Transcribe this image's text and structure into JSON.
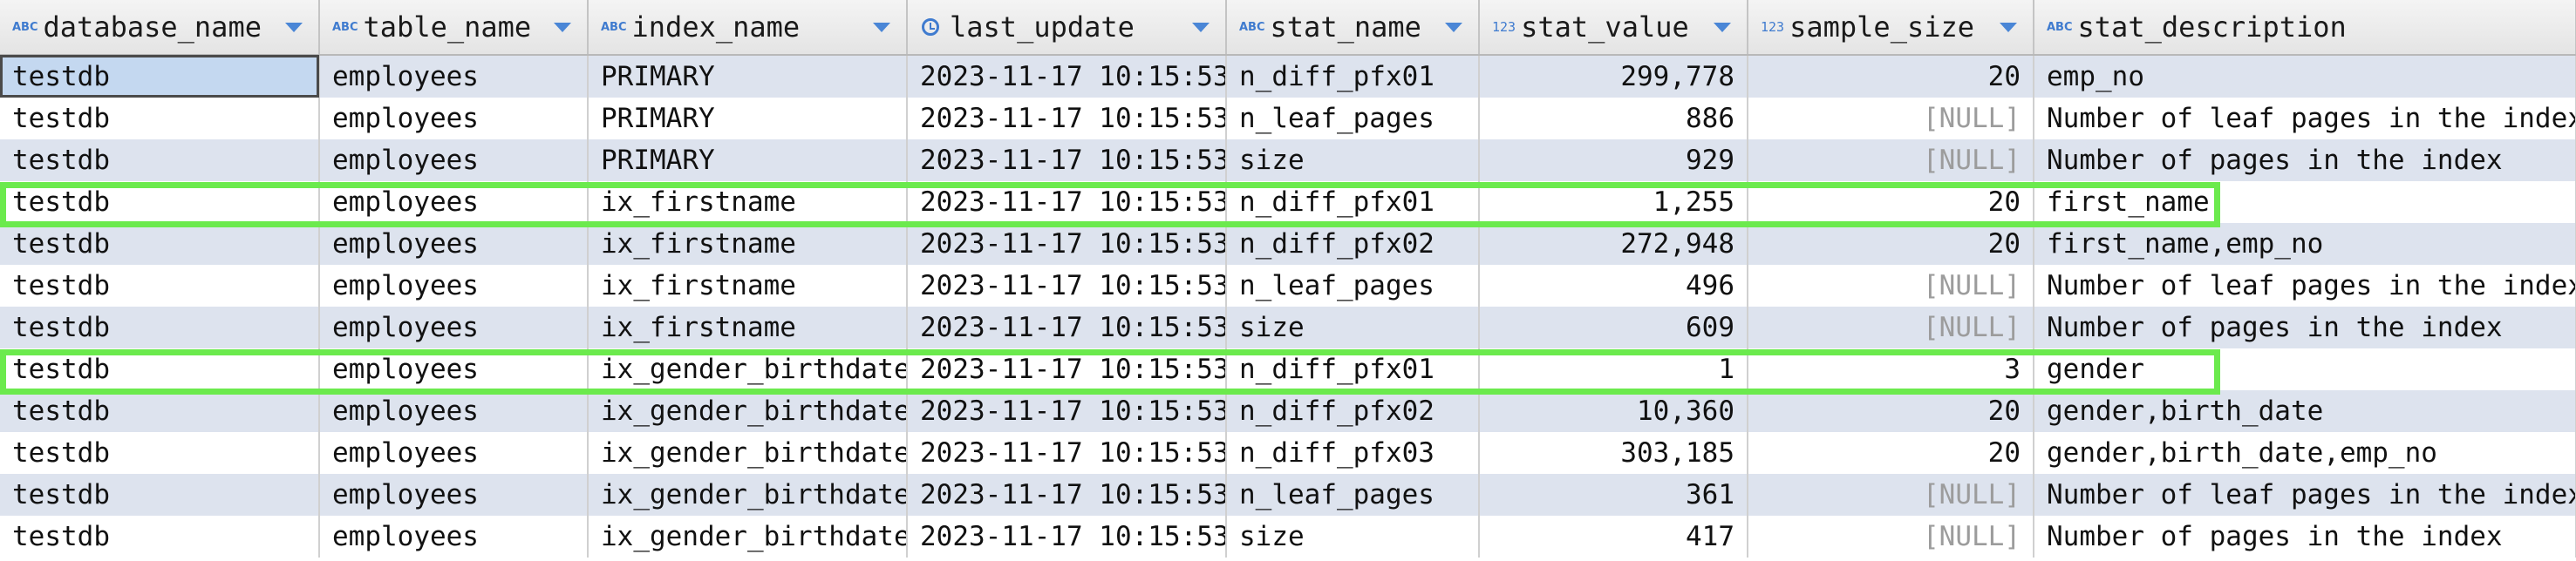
{
  "columns": [
    {
      "label": "database_name",
      "type_icon": "ABC"
    },
    {
      "label": "table_name",
      "type_icon": "ABC"
    },
    {
      "label": "index_name",
      "type_icon": "ABC"
    },
    {
      "label": "last_update",
      "type_icon": "clock"
    },
    {
      "label": "stat_name",
      "type_icon": "ABC"
    },
    {
      "label": "stat_value",
      "type_icon": "123"
    },
    {
      "label": "sample_size",
      "type_icon": "123"
    },
    {
      "label": "stat_description",
      "type_icon": "ABC"
    }
  ],
  "rows": [
    [
      "testdb",
      "employees",
      "PRIMARY",
      "2023-11-17 10:15:53",
      "n_diff_pfx01",
      "299,778",
      "20",
      "emp_no"
    ],
    [
      "testdb",
      "employees",
      "PRIMARY",
      "2023-11-17 10:15:53",
      "n_leaf_pages",
      "886",
      "[NULL]",
      "Number of leaf pages in the index"
    ],
    [
      "testdb",
      "employees",
      "PRIMARY",
      "2023-11-17 10:15:53",
      "size",
      "929",
      "[NULL]",
      "Number of pages in the index"
    ],
    [
      "testdb",
      "employees",
      "ix_firstname",
      "2023-11-17 10:15:53",
      "n_diff_pfx01",
      "1,255",
      "20",
      "first_name"
    ],
    [
      "testdb",
      "employees",
      "ix_firstname",
      "2023-11-17 10:15:53",
      "n_diff_pfx02",
      "272,948",
      "20",
      "first_name,emp_no"
    ],
    [
      "testdb",
      "employees",
      "ix_firstname",
      "2023-11-17 10:15:53",
      "n_leaf_pages",
      "496",
      "[NULL]",
      "Number of leaf pages in the index"
    ],
    [
      "testdb",
      "employees",
      "ix_firstname",
      "2023-11-17 10:15:53",
      "size",
      "609",
      "[NULL]",
      "Number of pages in the index"
    ],
    [
      "testdb",
      "employees",
      "ix_gender_birthdate",
      "2023-11-17 10:15:53",
      "n_diff_pfx01",
      "1",
      "3",
      "gender"
    ],
    [
      "testdb",
      "employees",
      "ix_gender_birthdate",
      "2023-11-17 10:15:53",
      "n_diff_pfx02",
      "10,360",
      "20",
      "gender,birth_date"
    ],
    [
      "testdb",
      "employees",
      "ix_gender_birthdate",
      "2023-11-17 10:15:53",
      "n_diff_pfx03",
      "303,185",
      "20",
      "gender,birth_date,emp_no"
    ],
    [
      "testdb",
      "employees",
      "ix_gender_birthdate",
      "2023-11-17 10:15:53",
      "n_leaf_pages",
      "361",
      "[NULL]",
      "Number of leaf pages in the index"
    ],
    [
      "testdb",
      "employees",
      "ix_gender_birthdate",
      "2023-11-17 10:15:53",
      "size",
      "417",
      "[NULL]",
      "Number of pages in the index"
    ]
  ],
  "colors": {
    "highlight": "#6bea4d",
    "row_alt": "#dde3ee",
    "icon": "#3f7bcf",
    "null_text": "#9c9c9c"
  }
}
